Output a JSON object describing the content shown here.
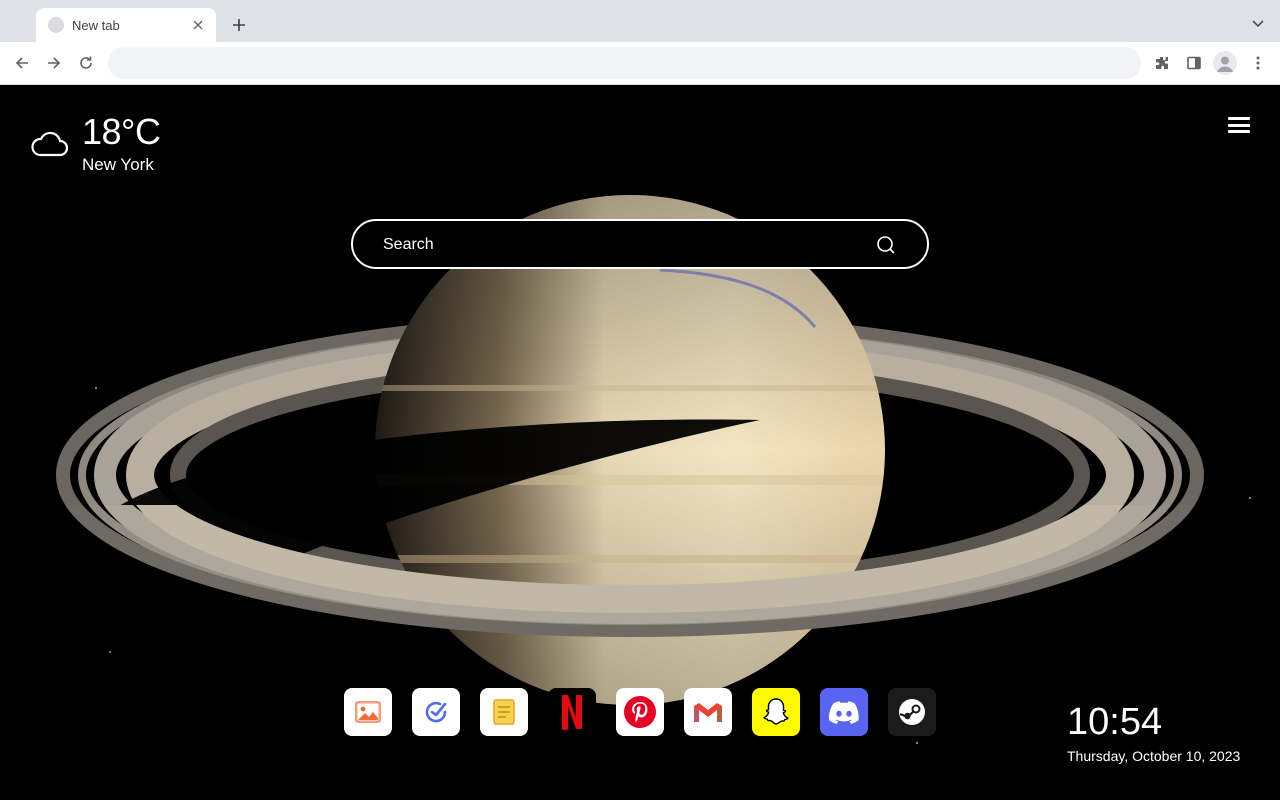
{
  "browser": {
    "tab": {
      "title": "New tab"
    },
    "address_bar": {
      "value": ""
    }
  },
  "weather": {
    "temperature": "18°C",
    "city": "New York",
    "icon": "cloud-icon"
  },
  "search": {
    "placeholder": "Search"
  },
  "shortcuts": [
    {
      "name": "photos",
      "icon": "photo-icon",
      "color": "#f26b3a"
    },
    {
      "name": "tasks",
      "icon": "check-circle-icon",
      "color": "#4a6cf7"
    },
    {
      "name": "notes",
      "icon": "note-icon",
      "color": "#f0b92b"
    },
    {
      "name": "netflix",
      "icon": "netflix-icon",
      "color": "#e50914"
    },
    {
      "name": "pinterest",
      "icon": "pinterest-icon",
      "color": "#e60023"
    },
    {
      "name": "gmail",
      "icon": "gmail-icon",
      "color": "#ea4335"
    },
    {
      "name": "snapchat",
      "icon": "snapchat-icon",
      "color": "#fffc00"
    },
    {
      "name": "discord",
      "icon": "discord-icon",
      "color": "#5865f2"
    },
    {
      "name": "steam",
      "icon": "steam-icon",
      "color": "#1b1b1b"
    }
  ],
  "clock": {
    "time": "10:54",
    "date": "Thursday, October 10, 2023"
  }
}
